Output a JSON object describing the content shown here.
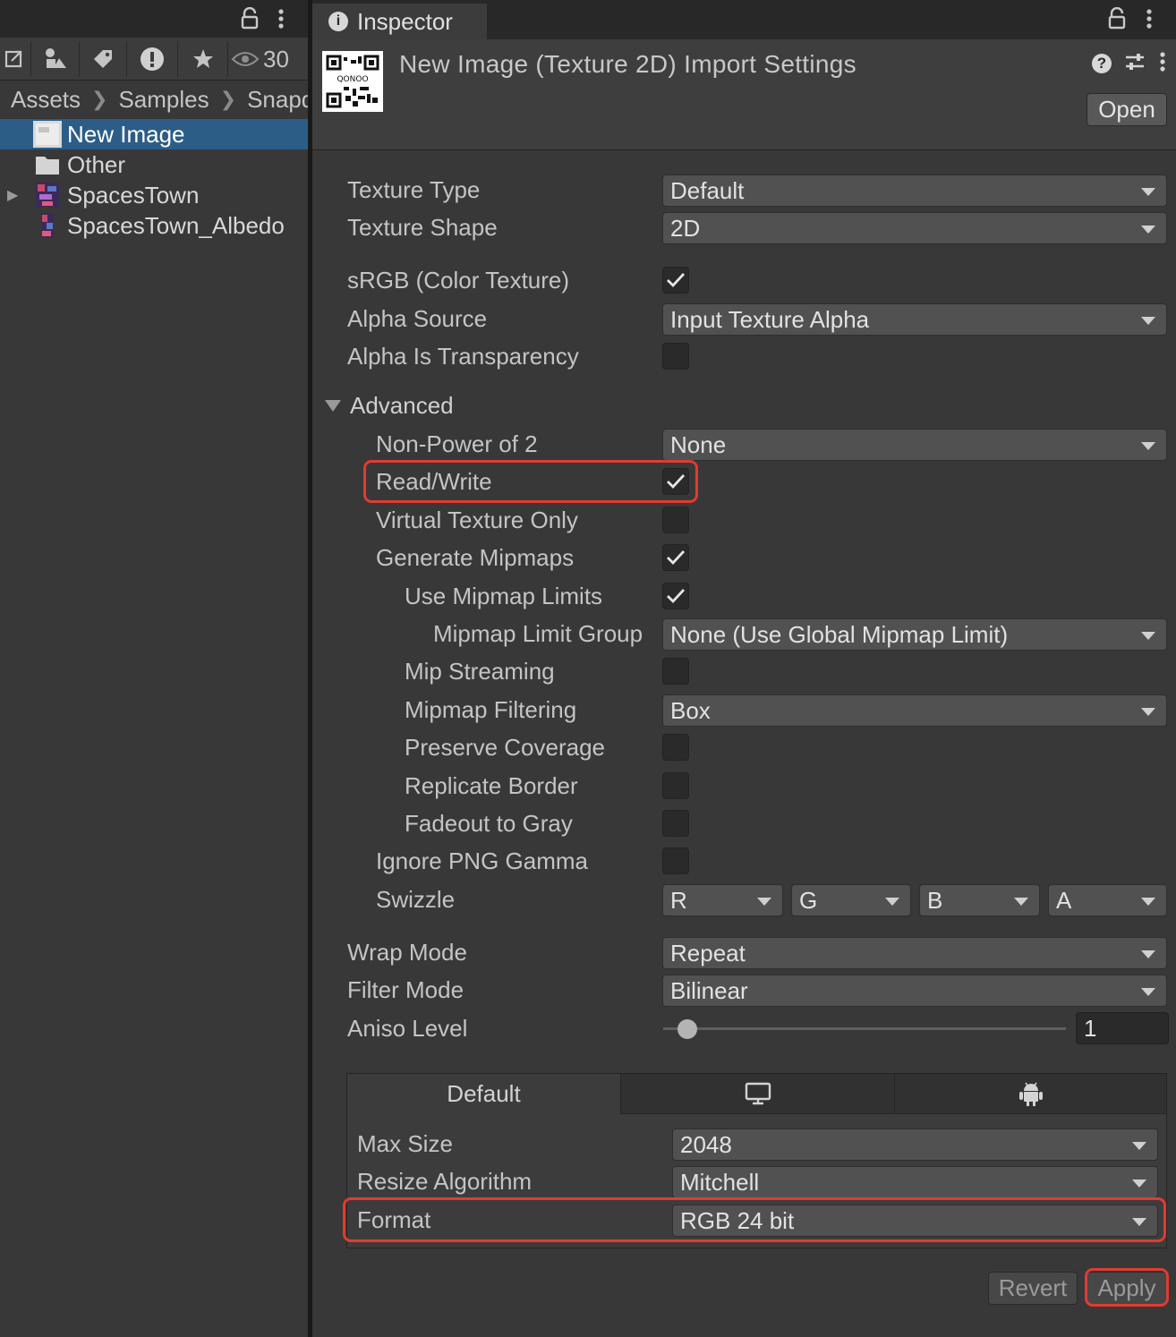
{
  "project_panel": {
    "view_count": "30",
    "breadcrumb": [
      "Assets",
      "Samples",
      "Snapd"
    ],
    "items": [
      {
        "label": "New Image",
        "selected": true,
        "icon": "image-thumbnail-icon"
      },
      {
        "label": "Other",
        "selected": false,
        "icon": "folder-icon"
      },
      {
        "label": "SpacesTown",
        "selected": false,
        "icon": "texture-thumbnail-icon",
        "expandable": true
      },
      {
        "label": "SpacesTown_Albedo",
        "selected": false,
        "icon": "texture-thumbnail-icon"
      }
    ]
  },
  "inspector": {
    "tab_label": "Inspector",
    "title": "New Image (Texture 2D) Import Settings",
    "qr_caption": "QONOO",
    "open_label": "Open",
    "texture_type": {
      "label": "Texture Type",
      "value": "Default"
    },
    "texture_shape": {
      "label": "Texture Shape",
      "value": "2D"
    },
    "srgb": {
      "label": "sRGB (Color Texture)",
      "checked": true
    },
    "alpha_source": {
      "label": "Alpha Source",
      "value": "Input Texture Alpha"
    },
    "alpha_is_transparency": {
      "label": "Alpha Is Transparency",
      "checked": false
    },
    "advanced_label": "Advanced",
    "non_power_of_2": {
      "label": "Non-Power of 2",
      "value": "None"
    },
    "read_write": {
      "label": "Read/Write",
      "checked": true
    },
    "virtual_texture_only": {
      "label": "Virtual Texture Only",
      "checked": false
    },
    "generate_mipmaps": {
      "label": "Generate Mipmaps",
      "checked": true
    },
    "use_mipmap_limits": {
      "label": "Use Mipmap Limits",
      "checked": true
    },
    "mipmap_limit_group": {
      "label": "Mipmap Limit Group",
      "value": "None (Use Global Mipmap Limit)"
    },
    "mip_streaming": {
      "label": "Mip Streaming",
      "checked": false
    },
    "mipmap_filtering": {
      "label": "Mipmap Filtering",
      "value": "Box"
    },
    "preserve_coverage": {
      "label": "Preserve Coverage",
      "checked": false
    },
    "replicate_border": {
      "label": "Replicate Border",
      "checked": false
    },
    "fadeout_to_gray": {
      "label": "Fadeout to Gray",
      "checked": false
    },
    "ignore_png_gamma": {
      "label": "Ignore PNG Gamma",
      "checked": false
    },
    "swizzle": {
      "label": "Swizzle",
      "values": [
        "R",
        "G",
        "B",
        "A"
      ]
    },
    "wrap_mode": {
      "label": "Wrap Mode",
      "value": "Repeat"
    },
    "filter_mode": {
      "label": "Filter Mode",
      "value": "Bilinear"
    },
    "aniso_level": {
      "label": "Aniso Level",
      "value": "1",
      "level_fraction": 0.06
    },
    "platform_tabs": [
      "Default",
      "monitor-icon",
      "android-icon"
    ],
    "max_size": {
      "label": "Max Size",
      "value": "2048"
    },
    "resize_algorithm": {
      "label": "Resize Algorithm",
      "value": "Mitchell"
    },
    "format": {
      "label": "Format",
      "value": "RGB 24 bit"
    },
    "revert_label": "Revert",
    "apply_label": "Apply"
  },
  "colors": {
    "selection": "#2c5d87",
    "highlight": "#e23b2f"
  }
}
